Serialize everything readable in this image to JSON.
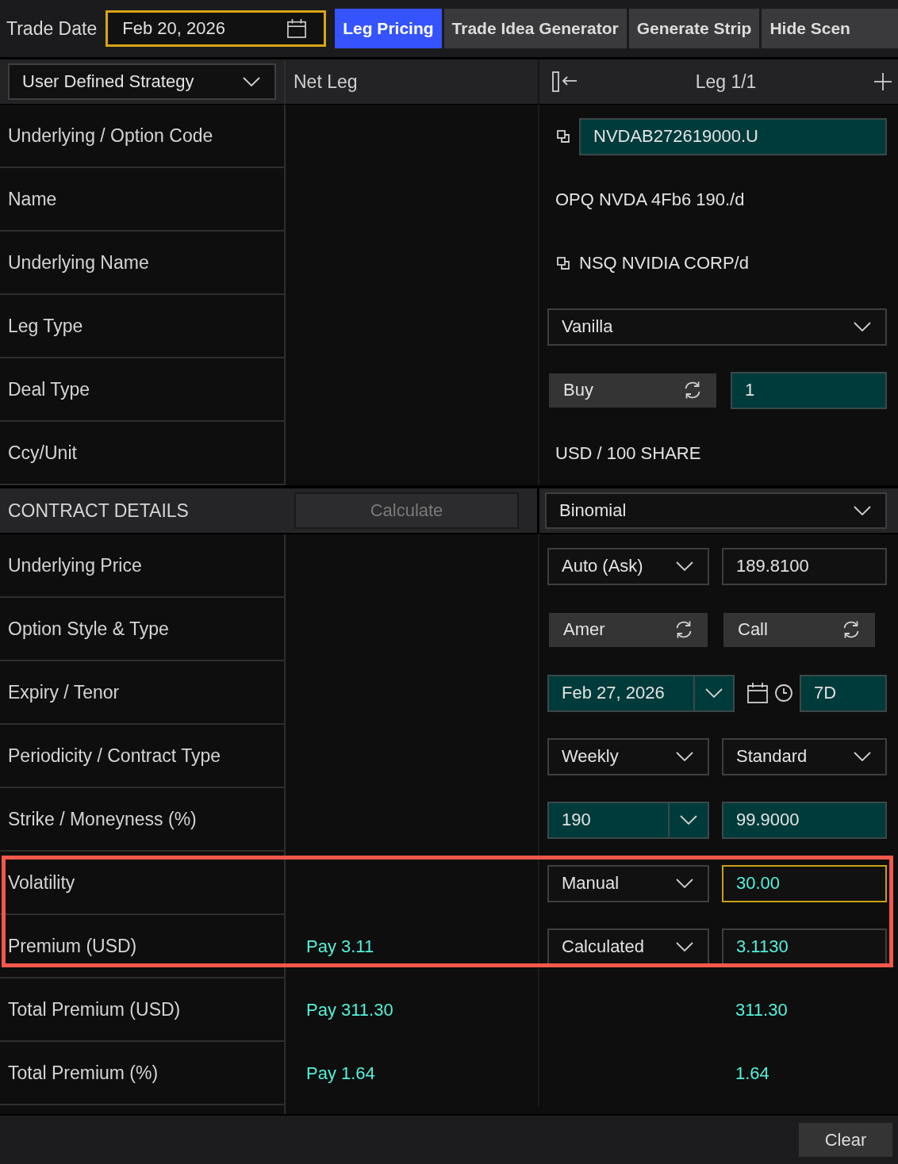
{
  "toolbar": {
    "trade_date_label": "Trade Date",
    "trade_date": "Feb 20, 2026",
    "tabs": [
      {
        "label": "Leg Pricing",
        "selected": true
      },
      {
        "label": "Trade Idea Generator",
        "selected": false
      },
      {
        "label": "Generate Strip",
        "selected": false
      },
      {
        "label": "Hide Scen",
        "selected": false
      }
    ]
  },
  "column_header": {
    "strategy": "User Defined Strategy",
    "net_leg": "Net Leg",
    "leg": "Leg 1/1"
  },
  "general_rows": [
    {
      "label": "Underlying / Option Code",
      "highlighted": false,
      "leg": [
        {
          "kind": "code_field",
          "value": "NVDAB272619000.U",
          "filled": true,
          "accent": false,
          "focused": false
        }
      ]
    },
    {
      "label": "Name",
      "highlighted": false,
      "leg": [
        {
          "kind": "text",
          "value": "OPQ NVDA 4Fb6 190./d"
        }
      ]
    },
    {
      "label": "Underlying Name",
      "highlighted": false,
      "leg": [
        {
          "kind": "linked_text",
          "value": "NSQ NVIDIA CORP/d"
        }
      ]
    },
    {
      "label": "Leg Type",
      "highlighted": false,
      "leg": [
        {
          "kind": "dropdown",
          "value": "Vanilla"
        }
      ]
    },
    {
      "label": "Deal Type",
      "highlighted": false,
      "leg": [
        {
          "kind": "toggle",
          "value": "Buy"
        },
        {
          "kind": "input",
          "value": "1",
          "filled": true,
          "accent": false,
          "focused": false
        }
      ]
    },
    {
      "label": "Ccy/Unit",
      "highlighted": false,
      "leg": [
        {
          "kind": "text",
          "value": "USD / 100 SHARE"
        }
      ]
    }
  ],
  "contract_details": {
    "title": "CONTRACT DETAILS",
    "calculate": {
      "label": "Calculate",
      "disabled": true
    },
    "model": "Binomial",
    "rows": [
      {
        "label": "Underlying Price",
        "highlighted": false,
        "leg": [
          {
            "kind": "dropdown",
            "value": "Auto (Ask)"
          },
          {
            "kind": "input",
            "value": "189.8100",
            "filled": false,
            "accent": false,
            "focused": false
          }
        ]
      },
      {
        "label": "Option Style & Type",
        "highlighted": false,
        "leg": [
          {
            "kind": "toggle",
            "value": "Amer"
          },
          {
            "kind": "toggle",
            "value": "Call"
          }
        ]
      },
      {
        "label": "Expiry / Tenor",
        "highlighted": false,
        "leg": [
          {
            "kind": "combo",
            "value": "Feb 27, 2026"
          },
          {
            "kind": "tenor_input",
            "value": "7D",
            "filled": true,
            "accent": false,
            "focused": false
          }
        ]
      },
      {
        "label": "Periodicity / Contract Type",
        "highlighted": false,
        "leg": [
          {
            "kind": "dropdown",
            "value": "Weekly"
          },
          {
            "kind": "dropdown",
            "value": "Standard"
          }
        ]
      },
      {
        "label": "Strike / Moneyness (%)",
        "highlighted": false,
        "leg": [
          {
            "kind": "combo",
            "value": "190"
          },
          {
            "kind": "input",
            "value": "99.9000",
            "filled": true,
            "accent": false,
            "focused": false
          }
        ]
      },
      {
        "label": "Volatility",
        "highlighted": true,
        "leg": [
          {
            "kind": "dropdown",
            "value": "Manual"
          },
          {
            "kind": "input",
            "value": "30.00",
            "filled": false,
            "accent": true,
            "focused": true
          }
        ]
      },
      {
        "label": "Premium (USD)",
        "highlighted": true,
        "net": "Pay 3.11",
        "leg": [
          {
            "kind": "dropdown",
            "value": "Calculated"
          },
          {
            "kind": "input",
            "value": "3.1130",
            "filled": false,
            "accent": true,
            "focused": false
          }
        ]
      },
      {
        "label": "Total Premium (USD)",
        "highlighted": false,
        "net": "Pay 311.30",
        "leg": [
          {
            "kind": "amount",
            "value": "311.30"
          }
        ]
      },
      {
        "label": "Total Premium (%)",
        "highlighted": false,
        "net": "Pay 1.64",
        "leg": [
          {
            "kind": "amount",
            "value": "1.64"
          }
        ]
      }
    ]
  },
  "footer": {
    "clear": "Clear"
  }
}
